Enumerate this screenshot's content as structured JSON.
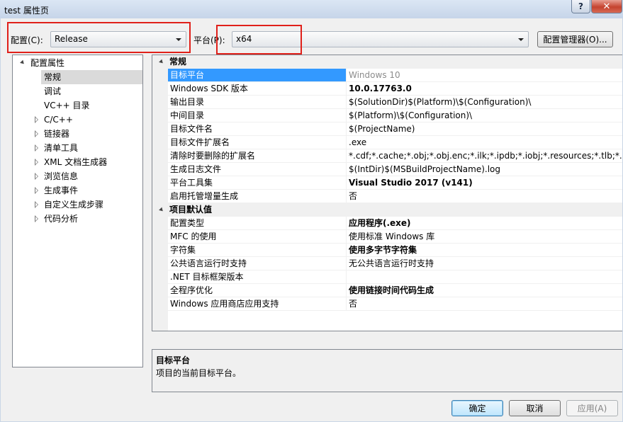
{
  "window": {
    "title": "test 属性页",
    "help_label": "?",
    "close_label": "✕"
  },
  "toolbar": {
    "config_label": "配置(C):",
    "config_value": "Release",
    "platform_label": "平台(P):",
    "platform_value": "x64",
    "config_manager_label": "配置管理器(O)..."
  },
  "tree": {
    "root": "配置属性",
    "items": [
      {
        "label": "常规",
        "selected": true,
        "expandable": false
      },
      {
        "label": "调试",
        "expandable": false
      },
      {
        "label": "VC++ 目录",
        "expandable": false
      },
      {
        "label": "C/C++",
        "expandable": true
      },
      {
        "label": "链接器",
        "expandable": true
      },
      {
        "label": "清单工具",
        "expandable": true
      },
      {
        "label": "XML 文档生成器",
        "expandable": true
      },
      {
        "label": "浏览信息",
        "expandable": true
      },
      {
        "label": "生成事件",
        "expandable": true
      },
      {
        "label": "自定义生成步骤",
        "expandable": true
      },
      {
        "label": "代码分析",
        "expandable": true
      }
    ]
  },
  "grid": {
    "categories": [
      {
        "name": "常规",
        "rows": [
          {
            "name": "目标平台",
            "value": "Windows 10",
            "style": "gray",
            "selected": true
          },
          {
            "name": "Windows SDK 版本",
            "value": "10.0.17763.0",
            "style": "bold"
          },
          {
            "name": "输出目录",
            "value": "$(SolutionDir)$(Platform)\\$(Configuration)\\"
          },
          {
            "name": "中间目录",
            "value": "$(Platform)\\$(Configuration)\\"
          },
          {
            "name": "目标文件名",
            "value": "$(ProjectName)"
          },
          {
            "name": "目标文件扩展名",
            "value": ".exe"
          },
          {
            "name": "清除时要删除的扩展名",
            "value": "*.cdf;*.cache;*.obj;*.obj.enc;*.ilk;*.ipdb;*.iobj;*.resources;*.tlb;*.tli;*.t"
          },
          {
            "name": "生成日志文件",
            "value": "$(IntDir)$(MSBuildProjectName).log"
          },
          {
            "name": "平台工具集",
            "value": "Visual Studio 2017 (v141)",
            "style": "bold"
          },
          {
            "name": "启用托管增量生成",
            "value": "否"
          }
        ]
      },
      {
        "name": "项目默认值",
        "rows": [
          {
            "name": "配置类型",
            "value": "应用程序(.exe)",
            "style": "bold"
          },
          {
            "name": "MFC 的使用",
            "value": "使用标准 Windows 库"
          },
          {
            "name": "字符集",
            "value": "使用多字节字符集",
            "style": "bold"
          },
          {
            "name": "公共语言运行时支持",
            "value": "无公共语言运行时支持"
          },
          {
            "name": ".NET 目标框架版本",
            "value": ""
          },
          {
            "name": "全程序优化",
            "value": "使用链接时间代码生成",
            "style": "bold"
          },
          {
            "name": "Windows 应用商店应用支持",
            "value": "否"
          }
        ]
      }
    ]
  },
  "description": {
    "title": "目标平台",
    "text": "项目的当前目标平台。"
  },
  "buttons": {
    "ok": "确定",
    "cancel": "取消",
    "apply": "应用(A)"
  },
  "colors": {
    "highlight_box": "#e0201a",
    "selection": "#3399ff"
  }
}
